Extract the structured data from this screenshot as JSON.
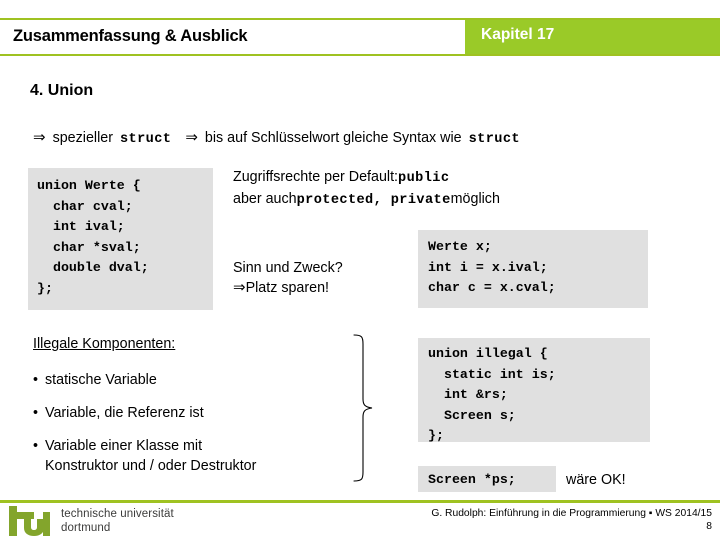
{
  "header": {
    "title": "Zusammenfassung & Ausblick",
    "chapter": "Kapitel 17",
    "band_color": "#9aca28",
    "rule_color": "#9fc221"
  },
  "section": {
    "heading": "4. Union"
  },
  "statement": {
    "arrow1": "⇒",
    "text1": "spezieller",
    "code1": "struct",
    "arrow2": "⇒",
    "text2": "bis auf Schlüsselwort gleiche Syntax wie",
    "code2": "struct"
  },
  "code_union_werte": "union Werte {\n  char cval;\n  int ival;\n  char *sval;\n  double dval;\n};",
  "access_rights": {
    "line1_text": "Zugriffsrechte per Default:",
    "line1_code": "public",
    "line2_prefix": "aber auch",
    "line2_code": "protected, private",
    "line2_suffix": "möglich"
  },
  "purpose": {
    "line1": "Sinn und Zweck?",
    "arrow": "⇒",
    "line2": "Platz sparen!"
  },
  "code_werte_usage": "Werte x;\nint i = x.ival;\nchar c = x.cval;",
  "illegal": {
    "heading": "Illegale Komponenten:",
    "bullet_char": "•",
    "items": [
      "statische Variable",
      "Variable, die Referenz ist",
      "Variable einer Klasse mit"
    ],
    "item3_continuation": "Konstruktor und / oder Destruktor"
  },
  "code_union_illegal": "union illegal {\n  static int is;\n  int &rs;\n  Screen s;\n};",
  "code_screen_ps": "Screen *ps;",
  "ok_note": "wäre OK!",
  "footer": {
    "logo_word": "tu",
    "logo_line1": "technische universität",
    "logo_line2": "dortmund",
    "logo_color": "#83a52c",
    "credit": "G. Rudolph: Einführung in die Programmierung ▪ WS 2014/15",
    "page": "8"
  }
}
